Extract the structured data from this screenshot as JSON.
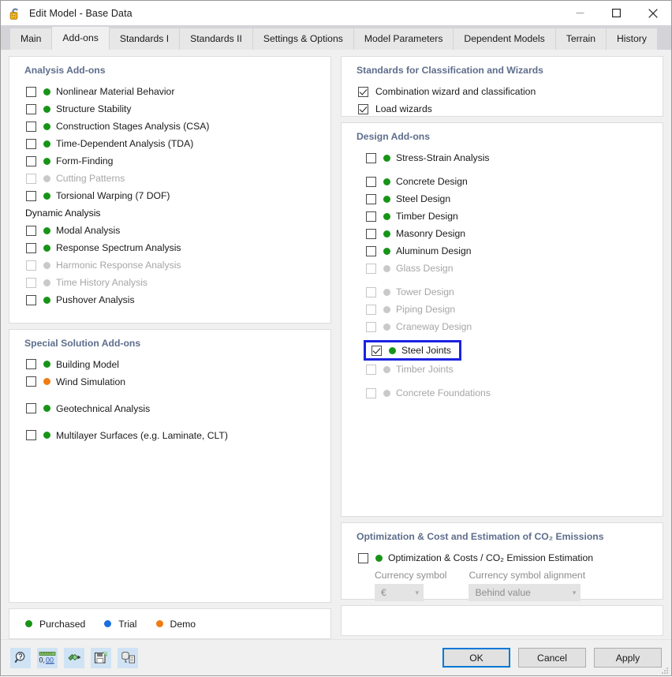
{
  "window": {
    "title": "Edit Model - Base Data",
    "app_icon": "lock-icon",
    "minimize": "—",
    "maximize": "☐",
    "close": "✕"
  },
  "tabs": [
    {
      "label": "Main",
      "active": false
    },
    {
      "label": "Add-ons",
      "active": true
    },
    {
      "label": "Standards I",
      "active": false
    },
    {
      "label": "Standards II",
      "active": false
    },
    {
      "label": "Settings & Options",
      "active": false
    },
    {
      "label": "Model Parameters",
      "active": false
    },
    {
      "label": "Dependent Models",
      "active": false
    },
    {
      "label": "Terrain",
      "active": false
    },
    {
      "label": "History",
      "active": false
    }
  ],
  "left": {
    "analysis": {
      "title": "Analysis Add-ons",
      "items": [
        {
          "label": "Nonlinear Material Behavior",
          "checked": false,
          "enabled": true,
          "dot": "green"
        },
        {
          "label": "Structure Stability",
          "checked": false,
          "enabled": true,
          "dot": "green"
        },
        {
          "label": "Construction Stages Analysis (CSA)",
          "checked": false,
          "enabled": true,
          "dot": "green"
        },
        {
          "label": "Time-Dependent Analysis (TDA)",
          "checked": false,
          "enabled": true,
          "dot": "green"
        },
        {
          "label": "Form-Finding",
          "checked": false,
          "enabled": true,
          "dot": "green"
        },
        {
          "label": "Cutting Patterns",
          "checked": false,
          "enabled": false,
          "dot": "gray"
        },
        {
          "label": "Torsional Warping (7 DOF)",
          "checked": false,
          "enabled": true,
          "dot": "green"
        }
      ],
      "dynamic_title": "Dynamic Analysis",
      "dynamic_items": [
        {
          "label": "Modal Analysis",
          "checked": false,
          "enabled": true,
          "dot": "green"
        },
        {
          "label": "Response Spectrum Analysis",
          "checked": false,
          "enabled": true,
          "dot": "green"
        },
        {
          "label": "Harmonic Response Analysis",
          "checked": false,
          "enabled": false,
          "dot": "gray"
        },
        {
          "label": "Time History Analysis",
          "checked": false,
          "enabled": false,
          "dot": "gray"
        },
        {
          "label": "Pushover Analysis",
          "checked": false,
          "enabled": true,
          "dot": "green"
        }
      ]
    },
    "special": {
      "title": "Special Solution Add-ons",
      "items": [
        {
          "label": "Building Model",
          "checked": false,
          "enabled": true,
          "dot": "green"
        },
        {
          "label": "Wind Simulation",
          "checked": false,
          "enabled": true,
          "dot": "orange"
        },
        {
          "label": "Geotechnical Analysis",
          "checked": false,
          "enabled": true,
          "dot": "green"
        },
        {
          "label": "Multilayer Surfaces (e.g. Laminate, CLT)",
          "checked": false,
          "enabled": true,
          "dot": "green"
        }
      ]
    },
    "legend": [
      {
        "label": "Purchased",
        "dot": "green"
      },
      {
        "label": "Trial",
        "dot": "blue"
      },
      {
        "label": "Demo",
        "dot": "orange"
      }
    ]
  },
  "right": {
    "standards": {
      "title": "Standards for Classification and Wizards",
      "items": [
        {
          "label": "Combination wizard and classification",
          "checked": true,
          "enabled": true,
          "dot": "none"
        },
        {
          "label": "Load wizards",
          "checked": true,
          "enabled": true,
          "dot": "none"
        }
      ]
    },
    "design": {
      "title": "Design Add-ons",
      "items": [
        {
          "label": "Stress-Strain Analysis",
          "checked": false,
          "enabled": true,
          "dot": "green"
        },
        {
          "label": "Concrete Design",
          "checked": false,
          "enabled": true,
          "dot": "green"
        },
        {
          "label": "Steel Design",
          "checked": false,
          "enabled": true,
          "dot": "green"
        },
        {
          "label": "Timber Design",
          "checked": false,
          "enabled": true,
          "dot": "green"
        },
        {
          "label": "Masonry Design",
          "checked": false,
          "enabled": true,
          "dot": "green"
        },
        {
          "label": "Aluminum Design",
          "checked": false,
          "enabled": true,
          "dot": "green"
        },
        {
          "label": "Glass Design",
          "checked": false,
          "enabled": false,
          "dot": "gray"
        },
        {
          "label": "Tower Design",
          "checked": false,
          "enabled": false,
          "dot": "gray"
        },
        {
          "label": "Piping Design",
          "checked": false,
          "enabled": false,
          "dot": "gray"
        },
        {
          "label": "Craneway Design",
          "checked": false,
          "enabled": false,
          "dot": "gray"
        }
      ],
      "highlighted": {
        "label": "Steel Joints",
        "checked": true,
        "enabled": true,
        "dot": "green",
        "focus_color": "#1c22e0"
      },
      "after_highlight": [
        {
          "label": "Timber Joints",
          "checked": false,
          "enabled": false,
          "dot": "gray"
        },
        {
          "label": "Concrete Foundations",
          "checked": false,
          "enabled": false,
          "dot": "gray"
        }
      ]
    },
    "optimization": {
      "title": "Optimization & Cost and Estimation of CO₂ Emissions",
      "main_item": {
        "label": "Optimization & Costs / CO₂ Emission Estimation",
        "checked": false,
        "enabled": true,
        "dot": "green"
      },
      "currency_symbol_label": "Currency symbol",
      "currency_symbol_value": "€",
      "currency_alignment_label": "Currency symbol alignment",
      "currency_alignment_value": "Behind value"
    }
  },
  "toolbar": [
    {
      "name": "help-search-icon",
      "glyph": "🔍"
    },
    {
      "name": "units-icon",
      "glyph": "0,00"
    },
    {
      "name": "import-icon",
      "glyph": "▶"
    },
    {
      "name": "save-icon",
      "glyph": "💾"
    },
    {
      "name": "database-icon",
      "glyph": "☰"
    }
  ],
  "buttons": {
    "ok": "OK",
    "cancel": "Cancel",
    "apply": "Apply"
  }
}
